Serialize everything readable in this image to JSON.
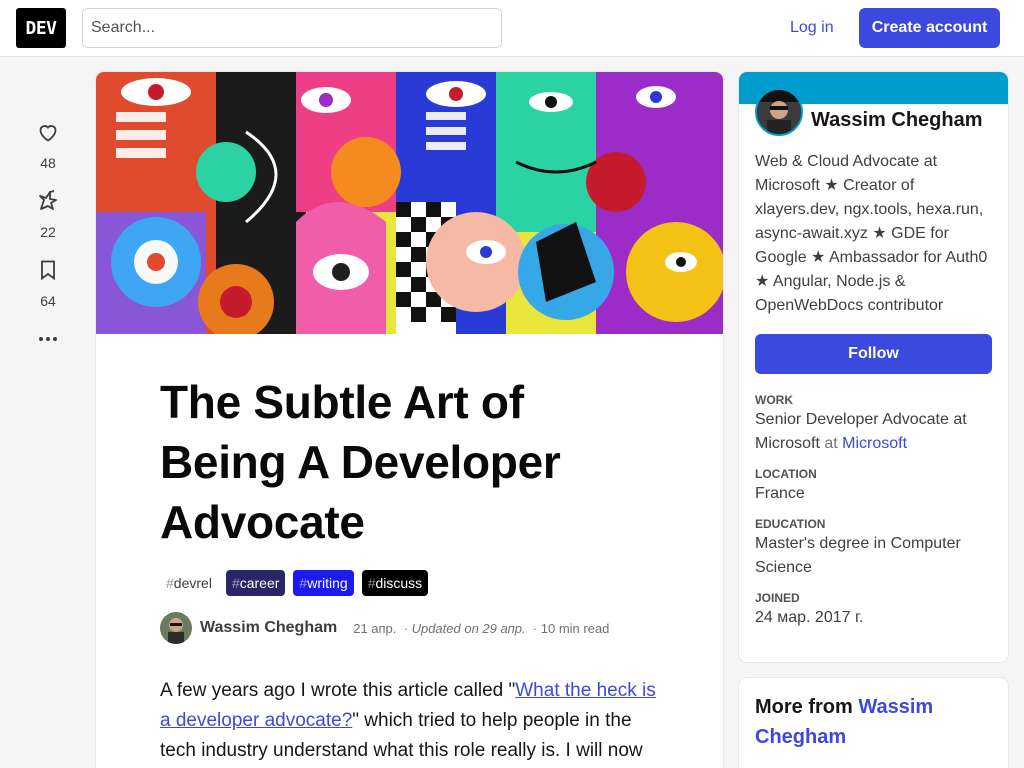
{
  "header": {
    "logo": "DEV",
    "search_placeholder": "Search...",
    "login_label": "Log in",
    "create_label": "Create account"
  },
  "reactions": [
    {
      "icon": "heart-icon",
      "count": "48"
    },
    {
      "icon": "unicorn-icon",
      "count": "22"
    },
    {
      "icon": "bookmark-icon",
      "count": "64"
    }
  ],
  "article": {
    "title": "The Subtle Art of Being A Developer Advocate",
    "tags": [
      {
        "hash": "#",
        "name": "devrel",
        "bg": "#ffffff",
        "fg": "#404040"
      },
      {
        "hash": "#",
        "name": "career",
        "bg": "#2a2566",
        "fg": "#ffffff"
      },
      {
        "hash": "#",
        "name": "writing",
        "bg": "#1b1bf0",
        "fg": "#ffffff"
      },
      {
        "hash": "#",
        "name": "discuss",
        "bg": "#000000",
        "fg": "#ffffff"
      }
    ],
    "author": "Wassim Chegham",
    "posted": "21 апр.",
    "updated": "Updated on 29 апр.",
    "read_time": "10 min read",
    "intro_before": "A few years ago I wrote this article called \"",
    "intro_link": "What the heck is a developer advocate?",
    "intro_after": "\" which tried to help people in the tech industry understand what this role",
    "intro_next": "really is. I will now try to look at some dos and"
  },
  "profile": {
    "name": "Wassim Chegham",
    "bio": "Web & Cloud Advocate at Microsoft ★ Creator of xlayers.dev, ngx.tools, hexa.run, async-await.xyz ★ GDE for Google ★ Ambassador for Auth0 ★ Angular, Node.js & OpenWebDocs contributor",
    "follow_label": "Follow",
    "brand_color": "#009ccb",
    "work_label": "Work",
    "work_value": "Senior Developer Advocate at Microsoft",
    "work_at": "at",
    "work_company": "Microsoft",
    "location_label": "Location",
    "location_value": "France",
    "education_label": "Education",
    "education_value": "Master's degree in Computer Science",
    "joined_label": "Joined",
    "joined_value": "24 мар. 2017 г."
  },
  "more_from": {
    "prefix": "More from",
    "name": "Wassim Chegham"
  },
  "colors": {
    "accent": "#3b49df",
    "background": "#f5f5f5"
  }
}
